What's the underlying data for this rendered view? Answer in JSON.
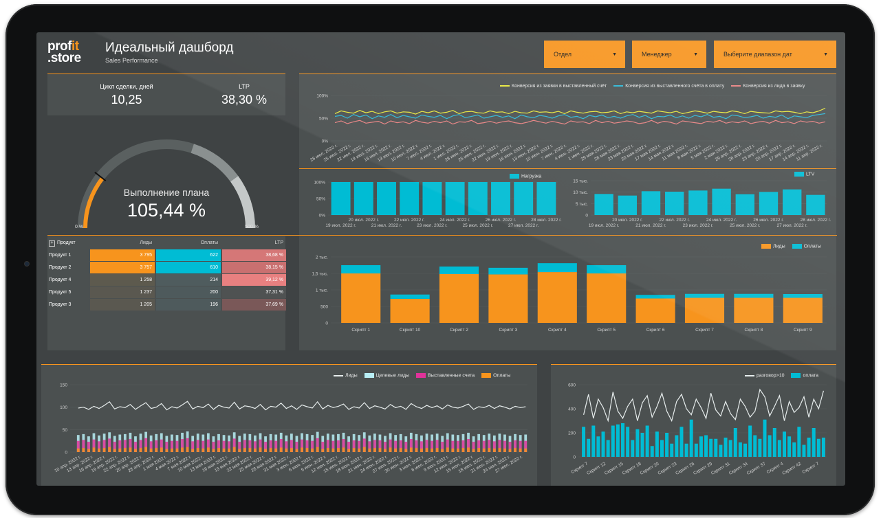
{
  "header": {
    "logo_line1": "prof",
    "logo_accent": "it",
    "logo_line2": ".store",
    "title": "Идеальный дашборд",
    "subtitle": "Sales Performance"
  },
  "filters": {
    "department": "Отдел",
    "manager": "Менеджер",
    "date_range": "Выберите диапазон дат"
  },
  "kpis": {
    "cycle_label": "Цикл сделки, дней",
    "cycle_value": "10,25",
    "ltp_label": "LTP",
    "ltp_value": "38,30 %"
  },
  "gauge": {
    "label": "Выполнение плана",
    "value_text": "105,44 %",
    "min_label": "0 %",
    "max_label": "500 %",
    "value": 105.44,
    "min": 0,
    "max": 500
  },
  "product_table": {
    "headers": [
      "Продукт",
      "Лиды",
      "Оплаты",
      "LTP"
    ],
    "rows": [
      {
        "product": "Продукт 1",
        "leads": "3 795",
        "payments": "622",
        "ltp": "38,68 %"
      },
      {
        "product": "Продукт 2",
        "leads": "3 757",
        "payments": "610",
        "ltp": "38,15 %"
      },
      {
        "product": "Продукт 4",
        "leads": "1 258",
        "payments": "214",
        "ltp": "39,12 %"
      },
      {
        "product": "Продукт 5",
        "leads": "1 237",
        "payments": "200",
        "ltp": "37,31 %"
      },
      {
        "product": "Продукт 3",
        "leads": "1 205",
        "payments": "196",
        "ltp": "37,69 %"
      }
    ]
  },
  "colors": {
    "accent": "#f7941d",
    "teal": "#00bcd4",
    "yellow": "#e8e83a",
    "coral": "#e88080",
    "pink": "#e0329a",
    "light_teal": "#b8eef5",
    "panel": "#4b5050",
    "screen": "#3f4344"
  },
  "chart_data": [
    {
      "id": "conversion",
      "type": "line",
      "y_ticks": [
        "100%",
        "50%",
        "0%"
      ],
      "ylim": [
        0,
        100
      ],
      "x_labels": [
        "28 июл. 2022 г.",
        "25 июл. 2022 г.",
        "22 июл. 2022 г.",
        "19 июл. 2022 г.",
        "16 июл. 2022 г.",
        "13 июл. 2022 г.",
        "10 июл. 2022 г.",
        "7 июл. 2022 г.",
        "4 июл. 2022 г.",
        "1 июл. 2022 г.",
        "28 июн. 2022 г.",
        "25 июн. 2022 г.",
        "22 июн. 2022 г.",
        "19 июн. 2022 г.",
        "16 июн. 2022 г.",
        "13 июн. 2022 г.",
        "10 июн. 2022 г.",
        "7 июн. 2022 г.",
        "4 июн. 2022 г.",
        "1 июн. 2022 г.",
        "29 мая 2022 г.",
        "26 мая 2022 г.",
        "23 мая 2022 г.",
        "20 мая 2022 г.",
        "17 мая 2022 г.",
        "14 мая 2022 г.",
        "11 мая 2022 г.",
        "8 мая 2022 г.",
        "5 мая 2022 г.",
        "2 мая 2022 г.",
        "29 апр. 2022 г.",
        "26 апр. 2022 г.",
        "23 апр. 2022 г.",
        "20 апр. 2022 г.",
        "17 апр. 2022 г.",
        "14 апр. 2022 г.",
        "11 апр. 2022 г."
      ],
      "series": [
        {
          "name": "Конверсия из заявки в выставленный счёт",
          "color": "#e8e83a",
          "values": [
            60,
            66,
            63,
            61,
            67,
            62,
            65,
            60,
            64,
            66,
            61,
            64,
            63,
            59,
            65,
            62,
            66,
            61,
            63,
            67,
            60,
            64,
            65,
            62,
            61,
            66,
            63,
            64,
            60,
            65,
            62,
            61,
            66,
            63,
            64,
            62,
            65,
            60,
            66,
            63,
            61,
            64,
            65,
            62,
            63,
            66,
            60,
            64,
            62,
            65,
            63,
            61,
            66,
            64,
            62,
            65,
            60,
            63,
            66,
            64,
            61,
            65,
            63,
            62,
            66,
            64,
            60,
            65,
            63,
            62,
            61,
            66,
            64,
            65,
            63,
            60,
            64,
            62,
            66,
            72
          ]
        },
        {
          "name": "Конверсия из выставленного счёта в оплату",
          "color": "#29b6d6",
          "values": [
            54,
            56,
            50,
            58,
            53,
            57,
            49,
            55,
            52,
            58,
            51,
            56,
            53,
            50,
            57,
            54,
            52,
            56,
            49,
            55,
            58,
            51,
            54,
            57,
            50,
            53,
            56,
            52,
            55,
            49,
            57,
            53,
            51,
            56,
            54,
            50,
            55,
            58,
            52,
            54,
            49,
            56,
            53,
            57,
            51,
            54,
            50,
            55,
            58,
            52,
            56,
            49,
            54,
            53,
            57,
            51,
            55,
            50,
            56,
            53,
            58,
            52,
            54,
            49,
            57,
            55,
            51,
            53,
            56,
            50,
            54,
            52,
            57,
            49,
            55,
            53,
            51,
            56,
            58,
            60
          ]
        },
        {
          "name": "Конверсия из лида в заявку",
          "color": "#e88080",
          "values": [
            40,
            44,
            38,
            42,
            45,
            39,
            41,
            43,
            37,
            44,
            40,
            42,
            38,
            45,
            41,
            39,
            43,
            40,
            44,
            37,
            42,
            41,
            45,
            38,
            40,
            43,
            39,
            42,
            44,
            40,
            38,
            41,
            45,
            42,
            39,
            43,
            40,
            37,
            44,
            41,
            42,
            38,
            45,
            40,
            43,
            39,
            41,
            44,
            42,
            38,
            40,
            45,
            39,
            43,
            41,
            37,
            44,
            42,
            40,
            38,
            43,
            41,
            45,
            39,
            42,
            40,
            44,
            38,
            41,
            43,
            39,
            45,
            40,
            42,
            38,
            44,
            41,
            43,
            39,
            42
          ]
        }
      ]
    },
    {
      "id": "load",
      "type": "bar",
      "series_name": "Нагрузка",
      "y_ticks": [
        "100%",
        "50%",
        "0%"
      ],
      "ylim": [
        0,
        100
      ],
      "categories": [
        "19 июл. 2022 г.",
        "20 июл. 2022 г.",
        "21 июл. 2022 г.",
        "22 июл. 2022 г.",
        "23 июл. 2022 г.",
        "24 июл. 2022 г.",
        "25 июл. 2022 г.",
        "26 июл. 2022 г.",
        "27 июл. 2022 г.",
        "28 июл. 2022 г."
      ],
      "values": [
        100,
        100,
        100,
        100,
        100,
        100,
        100,
        100,
        100,
        100
      ]
    },
    {
      "id": "ltv",
      "type": "bar",
      "series_name": "LTV",
      "y_ticks": [
        "15 тыс.",
        "10 тыс.",
        "5 тыс.",
        "0"
      ],
      "ylim": [
        0,
        15000
      ],
      "categories": [
        "19 июл. 2022 г.",
        "20 июл. 2022 г.",
        "21 июл. 2022 г.",
        "22 июл. 2022 г.",
        "23 июл. 2022 г.",
        "24 июл. 2022 г.",
        "25 июл. 2022 г.",
        "26 июл. 2022 г.",
        "27 июл. 2022 г.",
        "28 июл. 2022 г."
      ],
      "values": [
        9200,
        8500,
        10400,
        10200,
        10700,
        11500,
        9100,
        10100,
        11200,
        8800
      ]
    },
    {
      "id": "scripts",
      "type": "bar",
      "stacked": true,
      "y_ticks": [
        "2 тыс.",
        "1,5 тыс.",
        "1 тыс.",
        "500",
        "0"
      ],
      "ylim": [
        0,
        2000
      ],
      "categories": [
        "Скрипт 1",
        "Скрипт 10",
        "Скрипт 2",
        "Скрипт 3",
        "Скрипт 4",
        "Скрипт 5",
        "Скрипт 6",
        "Скрипт 7",
        "Скрипт 8",
        "Скрипт 9"
      ],
      "series": [
        {
          "name": "Лиды",
          "color": "#f7941d",
          "values": [
            1500,
            730,
            1480,
            1470,
            1540,
            1500,
            740,
            760,
            760,
            760
          ]
        },
        {
          "name": "Оплаты",
          "color": "#00bcd4",
          "values": [
            250,
            130,
            230,
            200,
            270,
            250,
            110,
            120,
            120,
            115
          ]
        }
      ]
    },
    {
      "id": "funnel_daily",
      "type": "bar",
      "y_ticks": [
        "150",
        "100",
        "50",
        "0"
      ],
      "ylim": [
        0,
        150
      ],
      "x_labels": [
        "10 апр. 2022 г.",
        "13 апр. 2022 г.",
        "16 апр. 2022 г.",
        "19 апр. 2022 г.",
        "22 апр. 2022 г.",
        "25 апр. 2022 г.",
        "28 апр. 2022 г.",
        "1 мая 2022 г.",
        "4 мая 2022 г.",
        "7 мая 2022 г.",
        "10 мая 2022 г.",
        "13 мая 2022 г.",
        "16 мая 2022 г.",
        "19 мая 2022 г.",
        "22 мая 2022 г.",
        "25 мая 2022 г.",
        "28 мая 2022 г.",
        "31 мая 2022 г.",
        "3 июн. 2022 г.",
        "6 июн. 2022 г.",
        "9 июн. 2022 г.",
        "12 июн. 2022 г.",
        "15 июн. 2022 г.",
        "18 июн. 2022 г.",
        "21 июн. 2022 г.",
        "24 июн. 2022 г.",
        "27 июн. 2022 г.",
        "30 июн. 2022 г.",
        "3 июл. 2022 г.",
        "6 июл. 2022 г.",
        "9 июл. 2022 г.",
        "12 июл. 2022 г.",
        "15 июл. 2022 г.",
        "18 июл. 2022 г.",
        "21 июл. 2022 г.",
        "24 июл. 2022 г.",
        "27 июл. 2022 г."
      ],
      "series": [
        {
          "name": "Лиды",
          "type": "line",
          "color": "#e6ecec",
          "values": [
            98,
            100,
            95,
            102,
            97,
            104,
            112,
            96,
            101,
            99,
            106,
            95,
            103,
            110,
            97,
            100,
            108,
            94,
            101,
            98,
            105,
            113,
            96,
            102,
            99,
            107,
            95,
            104,
            100,
            98,
            111,
            96,
            103,
            101,
            97,
            106,
            94,
            102,
            100,
            109,
            97,
            103,
            95,
            105,
            101,
            98,
            112,
            96,
            104,
            99,
            102,
            107,
            95,
            101,
            98,
            110,
            97,
            103,
            100,
            96,
            106,
            99,
            102,
            95,
            108,
            101,
            97,
            104,
            99,
            103,
            96,
            105,
            100,
            98,
            102,
            107,
            95,
            101,
            99,
            104,
            97,
            103,
            100,
            96,
            102,
            99,
            101
          ]
        },
        {
          "name": "Целевые лиды",
          "type": "bar",
          "color": "#b8eef5",
          "values": [
            38,
            40,
            35,
            42,
            37,
            41,
            44,
            36,
            39,
            40,
            43,
            35,
            41,
            45,
            37,
            40,
            42,
            36,
            39,
            38,
            43,
            46,
            36,
            41,
            39,
            42,
            35,
            40,
            38,
            37,
            44,
            36,
            41,
            40,
            37,
            42,
            35,
            40,
            39,
            43,
            37,
            41,
            36,
            42,
            40,
            38,
            45,
            36,
            41,
            39,
            40,
            43,
            35,
            40,
            38,
            44,
            37,
            41,
            39,
            36,
            42,
            38,
            40,
            35,
            43,
            40,
            37,
            41,
            39,
            41,
            36,
            42,
            39,
            38,
            40,
            43,
            35,
            40,
            38,
            41,
            37,
            41,
            39,
            36,
            40,
            38,
            39
          ]
        },
        {
          "name": "Выставленные счета",
          "type": "bar",
          "color": "#e0329a",
          "values": [
            25,
            27,
            23,
            28,
            24,
            27,
            30,
            23,
            26,
            27,
            29,
            23,
            27,
            31,
            24,
            26,
            28,
            23,
            25,
            25,
            29,
            31,
            24,
            27,
            25,
            28,
            23,
            26,
            25,
            24,
            30,
            23,
            27,
            26,
            24,
            28,
            23,
            26,
            25,
            29,
            24,
            27,
            23,
            28,
            26,
            25,
            31,
            23,
            27,
            25,
            26,
            29,
            23,
            26,
            25,
            30,
            24,
            27,
            26,
            23,
            28,
            25,
            26,
            23,
            29,
            26,
            24,
            27,
            25,
            27,
            23,
            28,
            25,
            25,
            26,
            29,
            23,
            26,
            25,
            27,
            24,
            27,
            25,
            23,
            26,
            25,
            25
          ]
        },
        {
          "name": "Оплаты",
          "type": "bar",
          "color": "#f7941d",
          "values": [
            8,
            9,
            7,
            10,
            8,
            9,
            11,
            7,
            8,
            9,
            10,
            7,
            9,
            11,
            8,
            9,
            10,
            7,
            8,
            8,
            10,
            11,
            7,
            9,
            8,
            10,
            7,
            9,
            8,
            8,
            11,
            7,
            9,
            9,
            8,
            10,
            7,
            9,
            8,
            10,
            8,
            9,
            7,
            10,
            9,
            8,
            11,
            7,
            9,
            8,
            9,
            10,
            7,
            9,
            8,
            11,
            8,
            9,
            9,
            7,
            10,
            8,
            9,
            7,
            10,
            9,
            8,
            9,
            8,
            9,
            7,
            10,
            8,
            8,
            9,
            10,
            7,
            9,
            8,
            9,
            8,
            9,
            8,
            7,
            9,
            8,
            8
          ]
        }
      ]
    },
    {
      "id": "scripts_calls",
      "type": "bar",
      "y_ticks": [
        "600",
        "400",
        "200",
        "0"
      ],
      "ylim": [
        0,
        600
      ],
      "x_labels": [
        "Скрипт 7",
        "Скрипт 12",
        "Скрипт 15",
        "Скрипт 18",
        "Скрипт 20",
        "Скрипт 23",
        "Скрипт 26",
        "Скрипт 29",
        "Скрипт 31",
        "Скрипт 34",
        "Скрипт 37",
        "Скрипт 4",
        "Скрипт 42",
        "Скрипт 7"
      ],
      "series": [
        {
          "name": "разговор>10",
          "type": "line",
          "color": "#e6ecec",
          "values": [
            350,
            520,
            320,
            480,
            410,
            300,
            540,
            380,
            320,
            420,
            480,
            300,
            450,
            510,
            330,
            420,
            530,
            380,
            300,
            460,
            520,
            400,
            350,
            480,
            410,
            320,
            530,
            390,
            340,
            460,
            360,
            310,
            480,
            420,
            330,
            380,
            560,
            500,
            340,
            420,
            510,
            300,
            460,
            370,
            410,
            500,
            330,
            480,
            400,
            550
          ]
        },
        {
          "name": "оплата",
          "type": "bar",
          "color": "#00bcd4",
          "values": [
            250,
            150,
            260,
            170,
            210,
            140,
            260,
            270,
            280,
            250,
            140,
            230,
            200,
            260,
            90,
            210,
            140,
            200,
            110,
            180,
            250,
            110,
            310,
            110,
            170,
            180,
            150,
            150,
            100,
            160,
            140,
            240,
            120,
            110,
            260,
            180,
            150,
            310,
            180,
            240,
            140,
            210,
            170,
            120,
            250,
            100,
            160,
            240,
            150,
            160
          ]
        }
      ]
    }
  ]
}
